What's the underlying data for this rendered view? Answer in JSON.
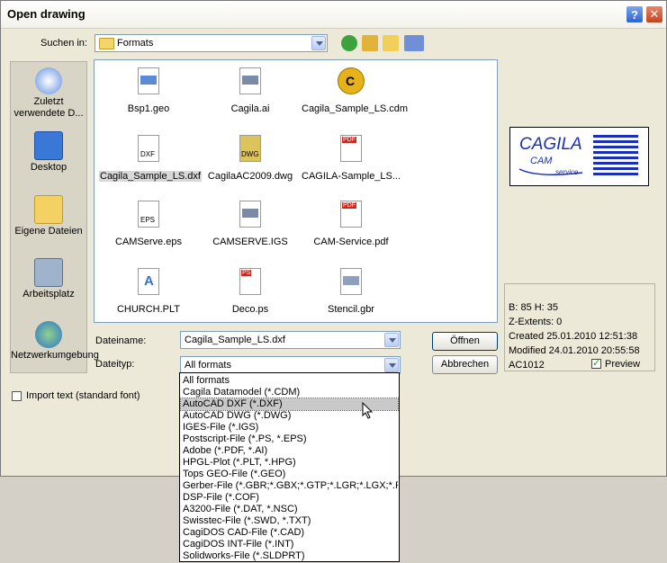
{
  "window": {
    "title": "Open drawing",
    "help_label": "?",
    "close_label": "✕"
  },
  "lookin": {
    "label": "Suchen in:",
    "value": "Formats"
  },
  "places": [
    {
      "label": "Zuletzt verwendete D..."
    },
    {
      "label": "Desktop"
    },
    {
      "label": "Eigene Dateien"
    },
    {
      "label": "Arbeitsplatz"
    },
    {
      "label": "Netzwerkumgebung"
    }
  ],
  "files": [
    {
      "name": "Bsp1.geo"
    },
    {
      "name": "Cagila.ai"
    },
    {
      "name": "Cagila_Sample_LS.cdm"
    },
    {
      "name": "Cagila_Sample_LS.dxf"
    },
    {
      "name": "CagilaAC2009.dwg"
    },
    {
      "name": "CAGILA-Sample_LS..."
    },
    {
      "name": "CAMServe.eps"
    },
    {
      "name": "CAMSERVE.IGS"
    },
    {
      "name": "CAM-Service.pdf"
    },
    {
      "name": "CHURCH.PLT"
    },
    {
      "name": "Deco.ps"
    },
    {
      "name": "Stencil.gbr"
    }
  ],
  "file_badges": {
    "dxf": "DXF",
    "dwg": "DWG",
    "eps": "EPS",
    "pdf": "PDF",
    "ps": "PS",
    "cdm": "C",
    "plt": "A"
  },
  "filename": {
    "label": "Dateiname:",
    "value": "Cagila_Sample_LS.dxf"
  },
  "filetype": {
    "label": "Dateityp:",
    "value": "All formats"
  },
  "buttons": {
    "open": "Öffnen",
    "cancel": "Abbrechen"
  },
  "preview": {
    "logo_top": "CAGILA",
    "logo_mid": "CAM",
    "logo_sub": "service"
  },
  "info": {
    "size": "B: 85 H: 35",
    "zextents": "Z-Extents: 0",
    "created": "Created 25.01.2010 12:51:38",
    "modified": "Modified 24.01.2010 20:55:58",
    "version": "AC1012",
    "preview_label": "Preview"
  },
  "import_text": {
    "label": "Import text (standard font)"
  },
  "filetype_options": [
    "All formats",
    "Cagila Datamodel (*.CDM)",
    "AutoCAD DXF (*.DXF)",
    "AutoCAD DWG (*.DWG)",
    "IGES-File (*.IGS)",
    "Postscript-File (*.PS, *.EPS)",
    "Adobe (*.PDF, *.AI)",
    "HPGL-Plot (*.PLT, *.HPG)",
    "Tops GEO-File (*.GEO)",
    "Gerber-File (*.GBR;*.GBX;*.GTP;*.LGR;*.LGX;*.PHO",
    "DSP-File (*.COF)",
    "A3200-File (*.DAT, *.NSC)",
    "Swisstec-File (*.SWD, *.TXT)",
    "CagiDOS CAD-File (*.CAD)",
    "CagiDOS INT-File (*.INT)",
    "Solidworks-File (*.SLDPRT)"
  ]
}
